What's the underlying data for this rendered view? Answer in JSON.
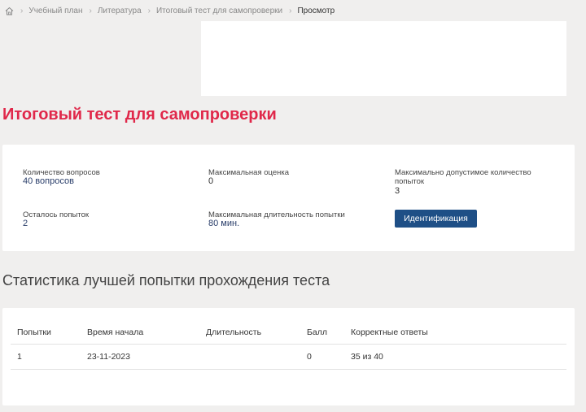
{
  "breadcrumb": {
    "home_icon": "home-icon",
    "items": [
      {
        "label": "Учебный план"
      },
      {
        "label": "Литература"
      },
      {
        "label": "Итоговый тест для самопроверки"
      },
      {
        "label": "Просмотр"
      }
    ]
  },
  "page": {
    "title": "Итоговый тест для самопроверки",
    "title_color": "#e0284a"
  },
  "info": {
    "questions_label": "Количество вопросов",
    "questions_value": "40 вопросов",
    "max_score_label": "Максимальная оценка",
    "max_score_value": "0",
    "max_attempts_label": "Максимально допустимое количество попыток",
    "max_attempts_value": "3",
    "attempts_left_label": "Осталось попыток",
    "attempts_left_value": "2",
    "max_duration_label": "Максимальная длительность попытки",
    "max_duration_value": "80 мин.",
    "ident_button": "Идентификация",
    "button_color": "#1e4f86"
  },
  "stats": {
    "title": "Статистика лучшей попытки прохождения теста",
    "columns": [
      "Попытки",
      "Время начала",
      "Длительность",
      "Балл",
      "Корректные ответы"
    ],
    "rows": [
      [
        "1",
        "23-11-2023",
        "",
        "0",
        "35 из 40"
      ]
    ]
  }
}
